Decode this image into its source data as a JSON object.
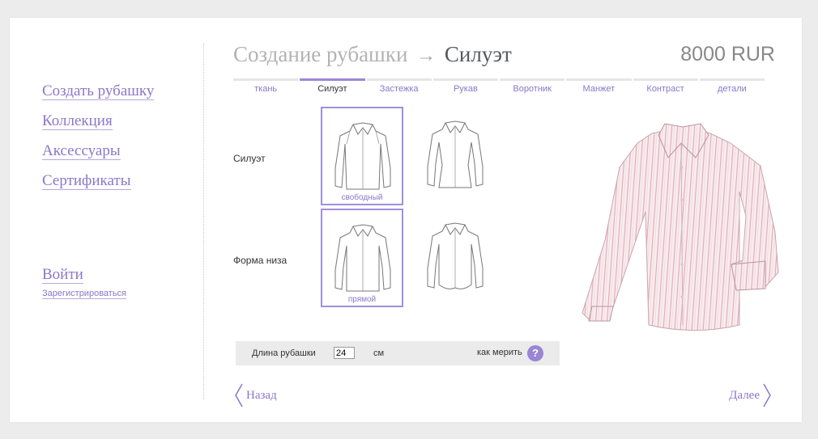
{
  "nav": {
    "items": [
      "Создать рубашку",
      "Коллекция",
      "Аксессуары",
      "Сертификаты"
    ],
    "login": "Войти",
    "register": "Зарегистрироваться"
  },
  "header": {
    "crumb": "Создание рубашки",
    "arrow": "→",
    "current": "Силуэт",
    "price": "8000 RUR"
  },
  "tabs": [
    "ткань",
    "Силуэт",
    "Застежка",
    "Рукав",
    "Воротник",
    "Манжет",
    "Контраст",
    "детали"
  ],
  "active_tab": "Силуэт",
  "rows": [
    {
      "label": "Силуэт",
      "selected_caption": "свободный"
    },
    {
      "label": "Форма низа",
      "selected_caption": "прямой"
    }
  ],
  "length": {
    "label": "Длина рубашки",
    "value": "24",
    "unit": "см",
    "how": "как мерить",
    "help_icon": "?"
  },
  "footer": {
    "back": "Назад",
    "next": "Далее"
  },
  "colors": {
    "accent": "#8a77c8",
    "selected_border": "#a090dc",
    "stripe": "#e8a8b8"
  }
}
